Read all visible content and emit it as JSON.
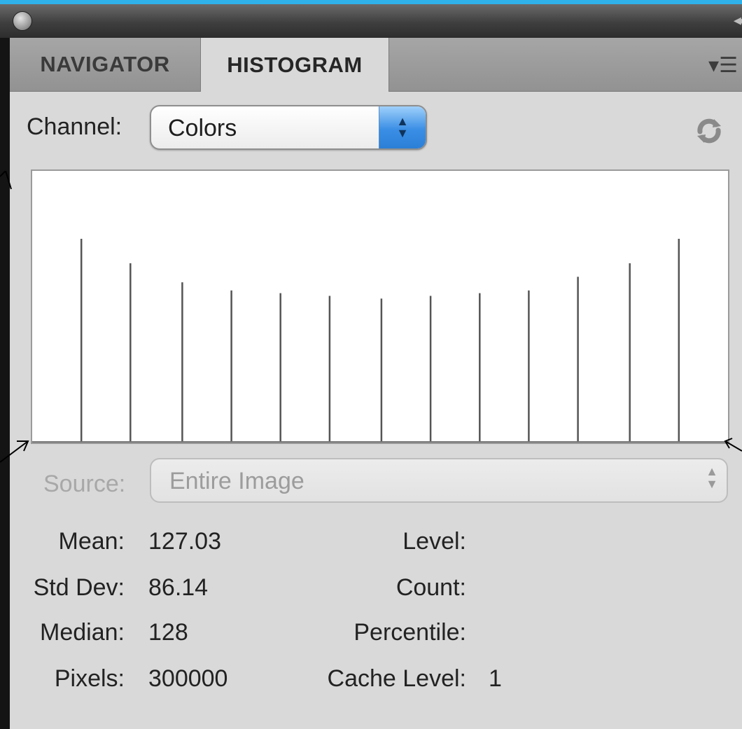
{
  "window": {
    "collapse_glyph": "◂◂"
  },
  "tabs": [
    {
      "label": "NAVIGATOR",
      "active": false
    },
    {
      "label": "HISTOGRAM",
      "active": true
    }
  ],
  "panel_menu_icon": "panel-menu-icon",
  "channel": {
    "label": "Channel:",
    "value": "Colors"
  },
  "source": {
    "label": "Source:",
    "value": "Entire Image",
    "disabled": true
  },
  "stats": {
    "mean_label": "Mean:",
    "mean_value": "127.03",
    "std_label": "Std Dev:",
    "std_value": "86.14",
    "median_label": "Median:",
    "median_value": "128",
    "pixels_label": "Pixels:",
    "pixels_value": "300000",
    "level_label": "Level:",
    "level_value": "",
    "count_label": "Count:",
    "count_value": "",
    "percentile_label": "Percentile:",
    "percentile_value": "",
    "cache_label": "Cache Level:",
    "cache_value": "1"
  },
  "colors": {
    "accent_blue": "#3a8ee5",
    "background_frame": "#2fb1ea",
    "panel": "#d9d9d9",
    "histogram_line": "#555555"
  },
  "chart_data": {
    "type": "bar",
    "x": [
      18,
      36,
      55,
      73,
      91,
      109,
      128,
      146,
      164,
      182,
      200,
      219,
      237
    ],
    "values": [
      75,
      66,
      59,
      56,
      55,
      54,
      53,
      54,
      55,
      56,
      61,
      66,
      75
    ],
    "xlim": [
      0,
      255
    ],
    "ylim": [
      0,
      100
    ],
    "grid": false
  }
}
